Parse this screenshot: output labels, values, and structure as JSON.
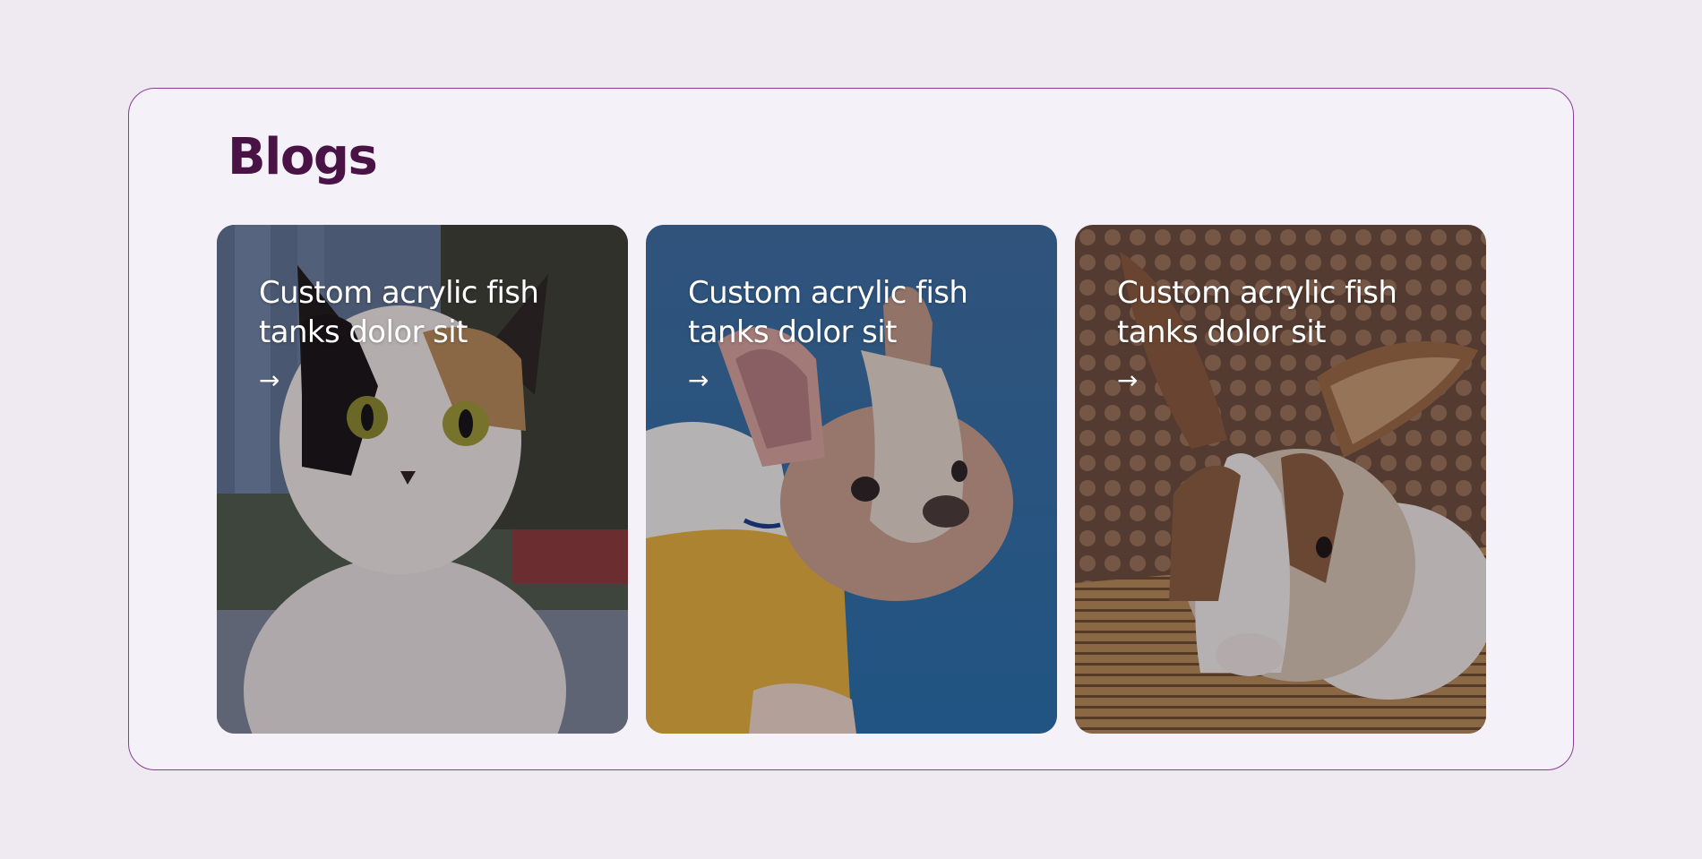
{
  "section": {
    "title": "Blogs"
  },
  "cards": [
    {
      "title": "Custom acrylic fish tanks dolor sit",
      "arrow": "→",
      "image": "calico-cat-photo"
    },
    {
      "title": "Custom acrylic fish tanks dolor sit",
      "arrow": "→",
      "image": "french-bulldog-photo"
    },
    {
      "title": "Custom acrylic fish tanks dolor sit",
      "arrow": "→",
      "image": "rabbit-photo"
    }
  ],
  "colors": {
    "page_bg": "#efe9f1",
    "panel_bg": "#f5f1f8",
    "panel_border": "#8b3c9a",
    "title": "#4a1346"
  }
}
